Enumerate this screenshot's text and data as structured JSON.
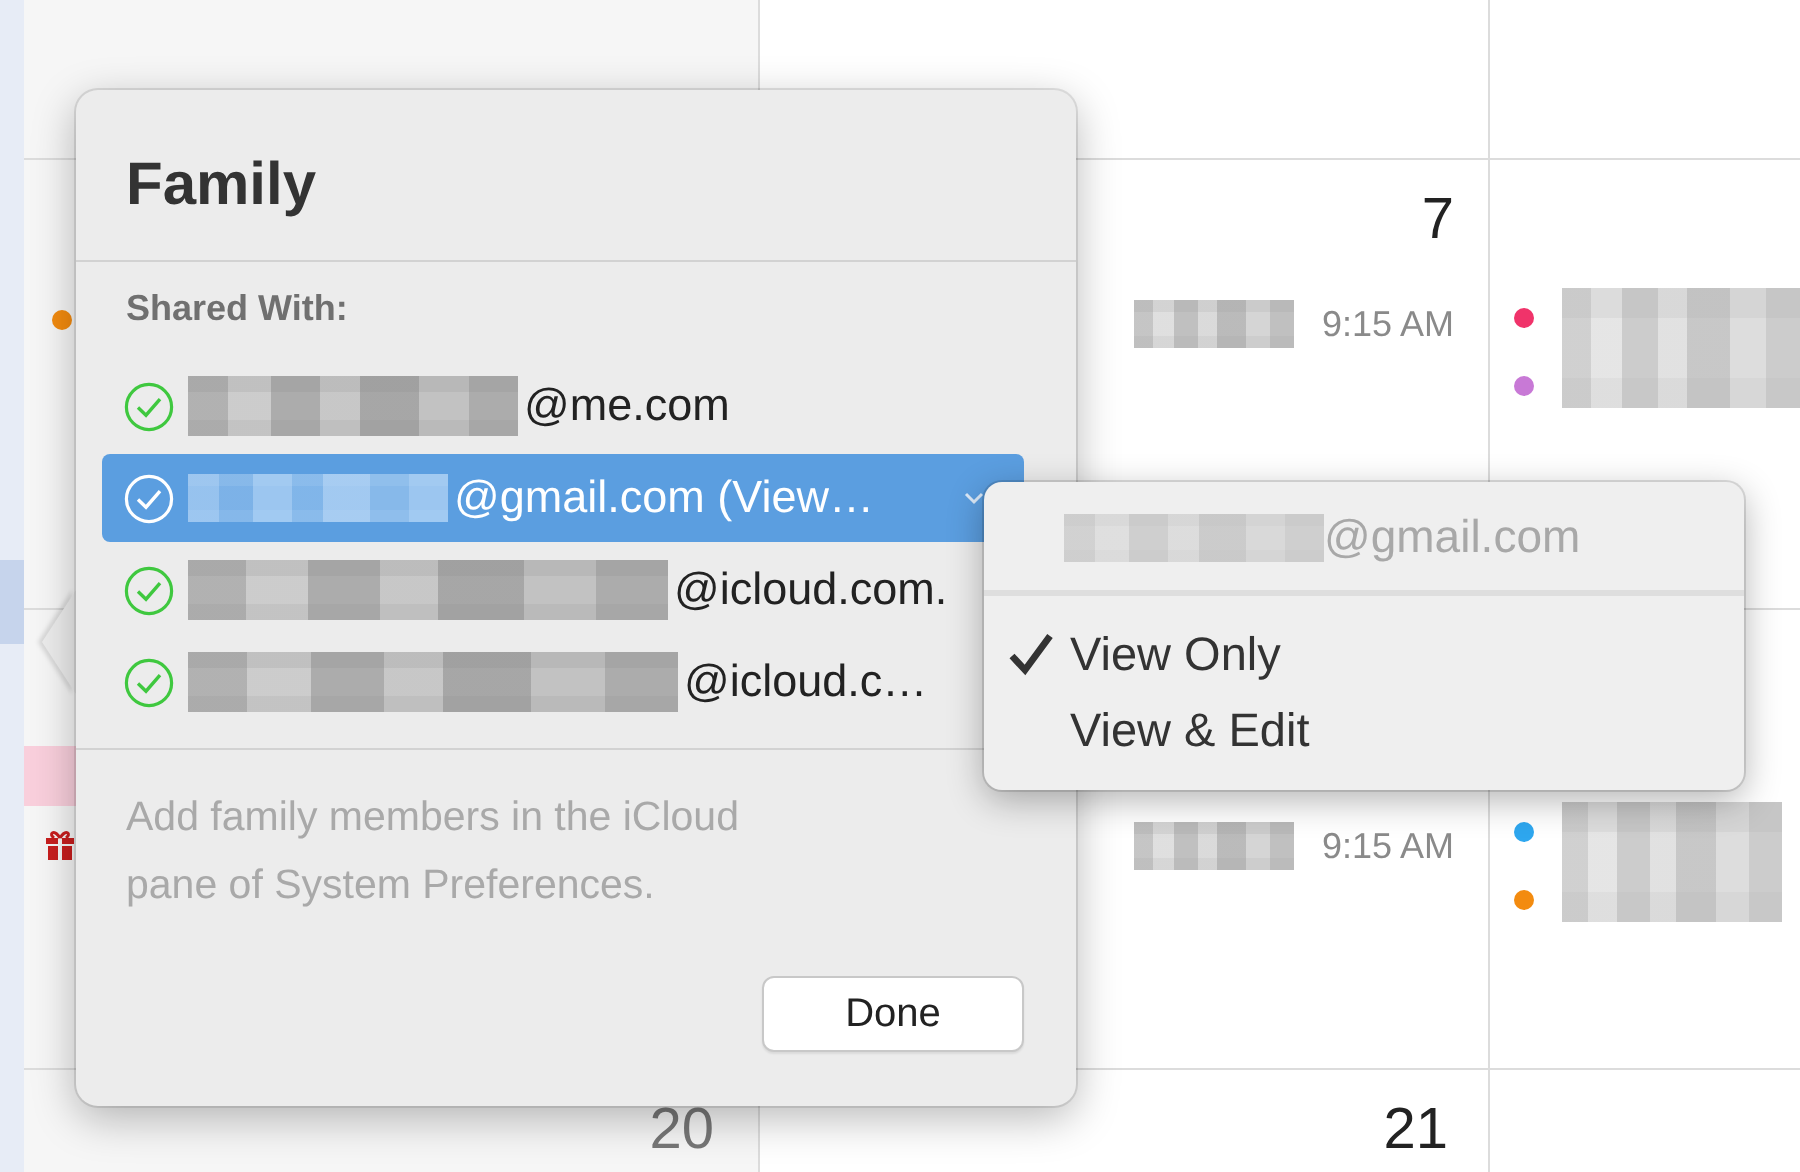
{
  "calendar": {
    "day_numbers": [
      "7",
      "20",
      "21"
    ],
    "events": [
      {
        "time": "9:15 AM"
      },
      {
        "time": "9:15 AM"
      }
    ],
    "event_dots": [
      {
        "color": "#f38b0f"
      },
      {
        "color": "#f0336a"
      },
      {
        "color": "#c879d6"
      },
      {
        "color": "#2ea7ef"
      },
      {
        "color": "#f38b0f"
      }
    ]
  },
  "popover": {
    "title": "Family",
    "section_label": "Shared With:",
    "members": [
      {
        "address": "@me.com",
        "accepted": true,
        "selected": false
      },
      {
        "address": "@gmail.com (View…",
        "accepted": true,
        "selected": true
      },
      {
        "address": "@icloud.com.",
        "accepted": true,
        "selected": false
      },
      {
        "address": "@icloud.c…",
        "accepted": true,
        "selected": false
      }
    ],
    "hint": "Add family members in the iCloud pane of System Preferences.",
    "done_button": "Done"
  },
  "access_menu": {
    "header": "@gmail.com",
    "options": [
      {
        "label": "View Only",
        "checked": true
      },
      {
        "label": "View & Edit",
        "checked": false
      }
    ]
  }
}
